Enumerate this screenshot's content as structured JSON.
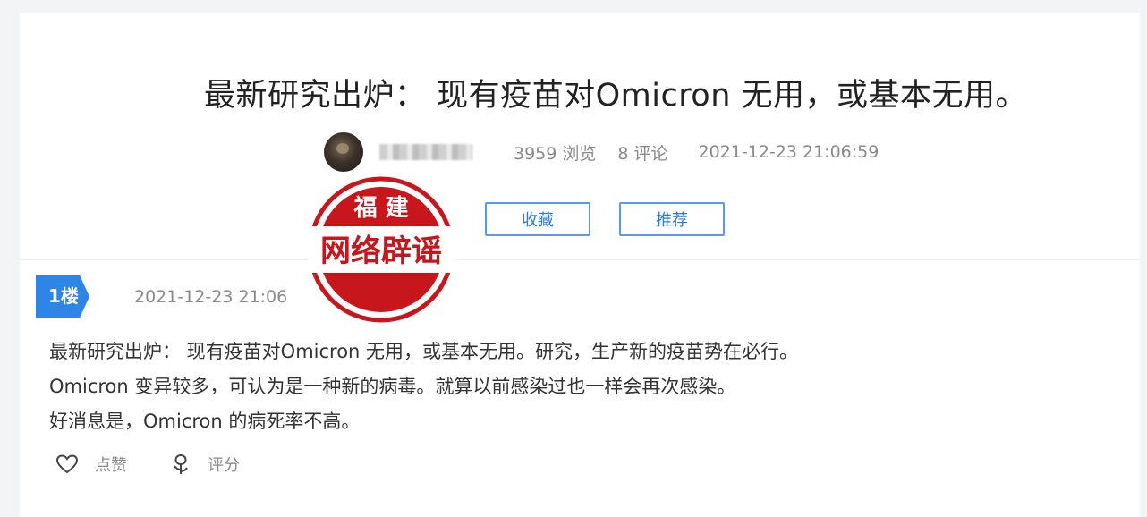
{
  "post": {
    "title": "最新研究出炉： 现有疫苗对Omicron 无用，或基本无用。",
    "views": "3959 浏览",
    "comments": "8 评论",
    "datetime": "2021-12-23 21:06:59",
    "buttons": {
      "favorite": "收藏",
      "recommend": "推荐"
    }
  },
  "reply": {
    "floor": "1楼",
    "datetime": "2021-12-23 21:06",
    "lines": [
      "最新研究出炉： 现有疫苗对Omicron 无用，或基本无用。研究，生产新的疫苗势在必行。",
      "Omicron 变异较多，可认为是一种新的病毒。就算以前感染过也一样会再次感染。",
      "好消息是，Omicron 的病死率不高。"
    ],
    "actions": {
      "like": "点赞",
      "rate": "评分"
    }
  },
  "stamp": {
    "top_text": "福 建",
    "main_text": "网络辟谣"
  },
  "colors": {
    "accent": "#2d86e6",
    "button_border": "#5a9be8",
    "stamp": "#c8161d"
  }
}
